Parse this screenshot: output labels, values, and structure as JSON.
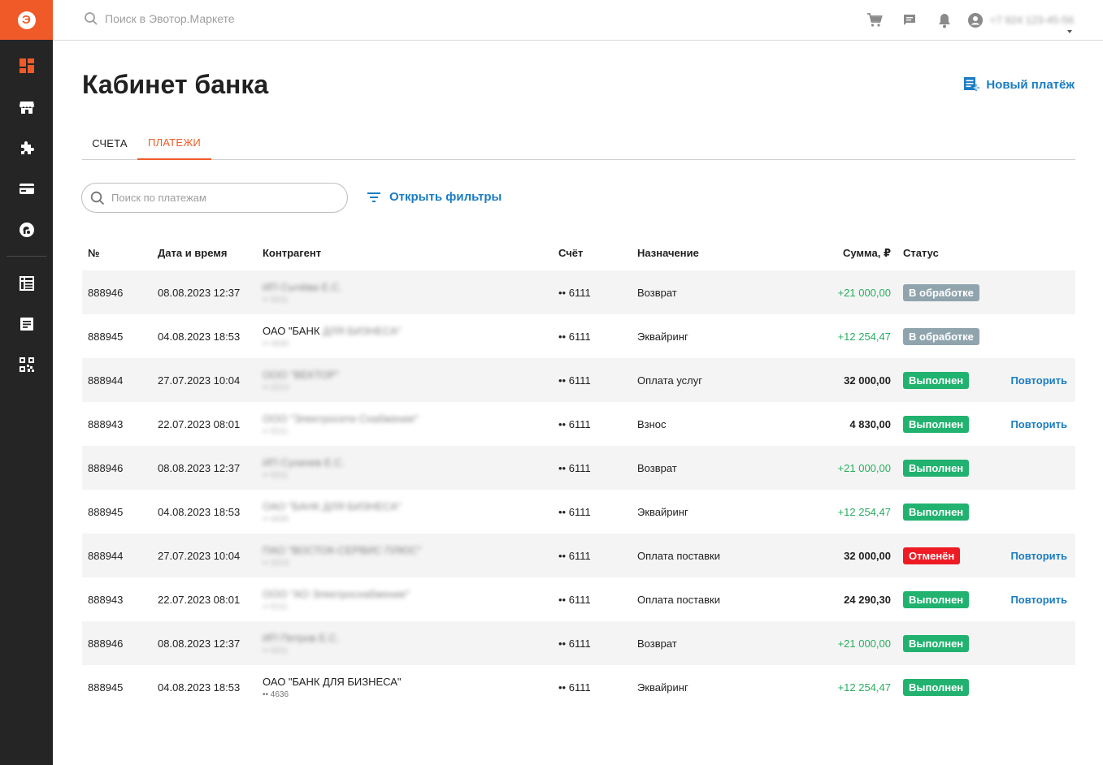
{
  "brand": {
    "accent": "#f05a28",
    "link": "#1a7dc3",
    "positive": "#27ae60"
  },
  "sidebar": {
    "items": [
      {
        "icon": "dashboard-icon"
      },
      {
        "icon": "store-icon"
      },
      {
        "icon": "puzzle-icon"
      },
      {
        "icon": "card-icon"
      },
      {
        "icon": "bank-icon"
      },
      {
        "icon": "table-icon"
      },
      {
        "icon": "receipt-icon"
      },
      {
        "icon": "qr-icon"
      }
    ]
  },
  "topbar": {
    "search_placeholder": "Поиск в Эвотор.Маркете",
    "phone": "+7 924 123-45-56"
  },
  "page": {
    "title": "Кабинет банка",
    "new_payment": "Новый платёж",
    "tabs": [
      {
        "label": "СЧЕТА"
      },
      {
        "label": "ПЛАТЕЖИ"
      }
    ],
    "search_placeholder": "Поиск по платежам",
    "filters_label": "Открыть фильтры"
  },
  "table": {
    "headers": {
      "num": "№",
      "date": "Дата и время",
      "counterparty": "Контрагент",
      "account": "Счёт",
      "purpose": "Назначение",
      "amount": "Сумма, ₽",
      "status": "Статус"
    },
    "status_colors": {
      "В обработке": "#90a4ae",
      "Выполнен": "#21b26f",
      "Отменён": "#ee1b24"
    },
    "rows": [
      {
        "num": "888946",
        "date": "08.08.2023  12:37",
        "cp": "ИП Сычёва Е.С.",
        "cp_acc": "•• 5211",
        "cp_blur": true,
        "account": "•• 6111",
        "purpose": "Возврат",
        "amount": "+21 000,00",
        "positive": true,
        "status": "В обработке",
        "action": ""
      },
      {
        "num": "888945",
        "date": "04.08.2023  18:53",
        "cp": "ОАО \"БАНК ДЛЯ БИЗНЕСА\"",
        "cp_acc": "•• 4636",
        "cp_blur": "partial",
        "cp_clear": "ОАО \"БАНК",
        "cp_hidden": " ДЛЯ БИЗНЕСА\"",
        "account": "•• 6111",
        "purpose": "Эквайринг",
        "amount": "+12 254,47",
        "positive": true,
        "status": "В обработке",
        "action": ""
      },
      {
        "num": "888944",
        "date": "27.07.2023  10:04",
        "cp": "ООО \"ВЕКТОР\"",
        "cp_acc": "•• 2213",
        "cp_blur": true,
        "account": "•• 6111",
        "purpose": "Оплата услуг",
        "amount": "32 000,00",
        "positive": false,
        "status": "Выполнен",
        "action": "Повторить"
      },
      {
        "num": "888943",
        "date": "22.07.2023  08:01",
        "cp": "ООО \"Электросети Снабжение\"",
        "cp_acc": "•• 5211",
        "cp_blur": true,
        "account": "•• 6111",
        "purpose": "Взнос",
        "amount": "4 830,00",
        "positive": false,
        "status": "Выполнен",
        "action": "Повторить"
      },
      {
        "num": "888946",
        "date": "08.08.2023  12:37",
        "cp": "ИП Сухачев Е.С.",
        "cp_acc": "•• 5211",
        "cp_blur": true,
        "account": "•• 6111",
        "purpose": "Возврат",
        "amount": "+21 000,00",
        "positive": true,
        "status": "Выполнен",
        "action": ""
      },
      {
        "num": "888945",
        "date": "04.08.2023  18:53",
        "cp": "ОАО \"БАНК ДЛЯ БИЗНЕСА\"",
        "cp_acc": "•• 4636",
        "cp_blur": true,
        "account": "•• 6111",
        "purpose": "Эквайринг",
        "amount": "+12 254,47",
        "positive": true,
        "status": "Выполнен",
        "action": ""
      },
      {
        "num": "888944",
        "date": "27.07.2023  10:04",
        "cp": "ПАО \"ВОСТОК-СЕРВИС ПЛЮС\"",
        "cp_acc": "•• 2213",
        "cp_blur": true,
        "account": "•• 6111",
        "purpose": "Оплата поставки",
        "amount": "32 000,00",
        "positive": false,
        "status": "Отменён",
        "action": "Повторить"
      },
      {
        "num": "888943",
        "date": "22.07.2023  08:01",
        "cp": "ООО \"АО Электроснабжение\"",
        "cp_acc": "•• 5211",
        "cp_blur": true,
        "account": "•• 6111",
        "purpose": "Оплата поставки",
        "amount": "24 290,30",
        "positive": false,
        "status": "Выполнен",
        "action": "Повторить"
      },
      {
        "num": "888946",
        "date": "08.08.2023  12:37",
        "cp": "ИП Петров Е.С.",
        "cp_acc": "•• 5211",
        "cp_blur": true,
        "account": "•• 6111",
        "purpose": "Возврат",
        "amount": "+21 000,00",
        "positive": true,
        "status": "Выполнен",
        "action": ""
      },
      {
        "num": "888945",
        "date": "04.08.2023  18:53",
        "cp": "ОАО \"БАНК ДЛЯ БИЗНЕСА\"",
        "cp_acc": "•• 4636",
        "cp_blur": false,
        "account": "•• 6111",
        "purpose": "Эквайринг",
        "amount": "+12 254,47",
        "positive": true,
        "status": "Выполнен",
        "action": ""
      }
    ]
  }
}
